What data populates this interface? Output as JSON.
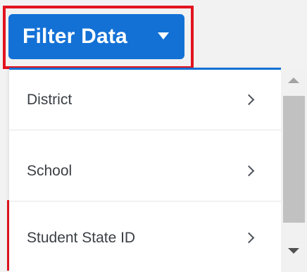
{
  "filter_button": {
    "label": "Filter Data",
    "icon": "caret-down-icon"
  },
  "menu": {
    "items": [
      {
        "label": "District",
        "icon": "chevron-right-icon"
      },
      {
        "label": "School",
        "icon": "chevron-right-icon"
      },
      {
        "label": "Student State ID",
        "icon": "chevron-right-icon"
      }
    ]
  },
  "colors": {
    "accent": "#1371d6",
    "highlight": "#e3141f",
    "text": "#3a3f45"
  }
}
